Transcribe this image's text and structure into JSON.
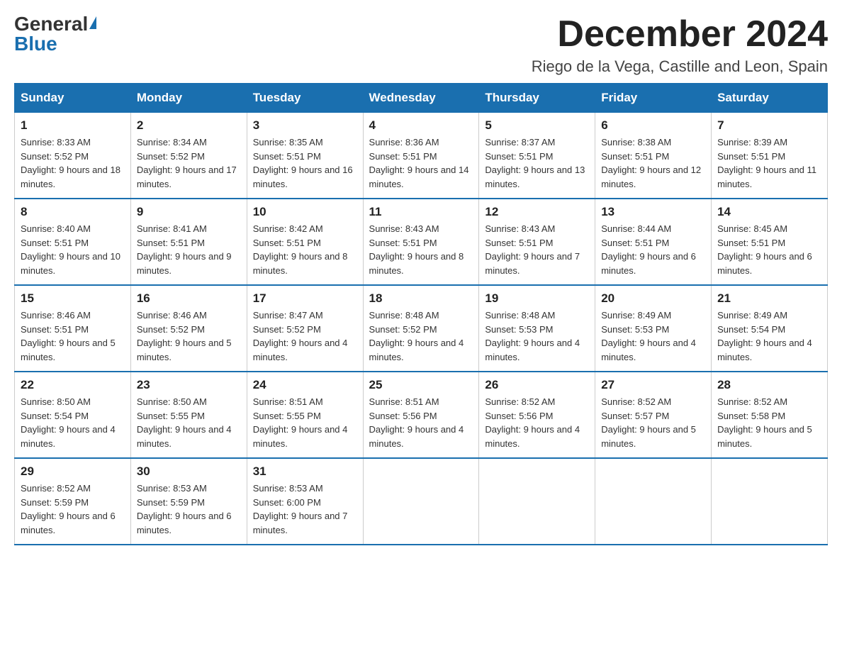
{
  "header": {
    "logo_general": "General",
    "logo_blue": "Blue",
    "month_title": "December 2024",
    "location": "Riego de la Vega, Castille and Leon, Spain"
  },
  "days_of_week": [
    "Sunday",
    "Monday",
    "Tuesday",
    "Wednesday",
    "Thursday",
    "Friday",
    "Saturday"
  ],
  "weeks": [
    [
      {
        "day": "1",
        "sunrise": "8:33 AM",
        "sunset": "5:52 PM",
        "daylight": "9 hours and 18 minutes."
      },
      {
        "day": "2",
        "sunrise": "8:34 AM",
        "sunset": "5:52 PM",
        "daylight": "9 hours and 17 minutes."
      },
      {
        "day": "3",
        "sunrise": "8:35 AM",
        "sunset": "5:51 PM",
        "daylight": "9 hours and 16 minutes."
      },
      {
        "day": "4",
        "sunrise": "8:36 AM",
        "sunset": "5:51 PM",
        "daylight": "9 hours and 14 minutes."
      },
      {
        "day": "5",
        "sunrise": "8:37 AM",
        "sunset": "5:51 PM",
        "daylight": "9 hours and 13 minutes."
      },
      {
        "day": "6",
        "sunrise": "8:38 AM",
        "sunset": "5:51 PM",
        "daylight": "9 hours and 12 minutes."
      },
      {
        "day": "7",
        "sunrise": "8:39 AM",
        "sunset": "5:51 PM",
        "daylight": "9 hours and 11 minutes."
      }
    ],
    [
      {
        "day": "8",
        "sunrise": "8:40 AM",
        "sunset": "5:51 PM",
        "daylight": "9 hours and 10 minutes."
      },
      {
        "day": "9",
        "sunrise": "8:41 AM",
        "sunset": "5:51 PM",
        "daylight": "9 hours and 9 minutes."
      },
      {
        "day": "10",
        "sunrise": "8:42 AM",
        "sunset": "5:51 PM",
        "daylight": "9 hours and 8 minutes."
      },
      {
        "day": "11",
        "sunrise": "8:43 AM",
        "sunset": "5:51 PM",
        "daylight": "9 hours and 8 minutes."
      },
      {
        "day": "12",
        "sunrise": "8:43 AM",
        "sunset": "5:51 PM",
        "daylight": "9 hours and 7 minutes."
      },
      {
        "day": "13",
        "sunrise": "8:44 AM",
        "sunset": "5:51 PM",
        "daylight": "9 hours and 6 minutes."
      },
      {
        "day": "14",
        "sunrise": "8:45 AM",
        "sunset": "5:51 PM",
        "daylight": "9 hours and 6 minutes."
      }
    ],
    [
      {
        "day": "15",
        "sunrise": "8:46 AM",
        "sunset": "5:51 PM",
        "daylight": "9 hours and 5 minutes."
      },
      {
        "day": "16",
        "sunrise": "8:46 AM",
        "sunset": "5:52 PM",
        "daylight": "9 hours and 5 minutes."
      },
      {
        "day": "17",
        "sunrise": "8:47 AM",
        "sunset": "5:52 PM",
        "daylight": "9 hours and 4 minutes."
      },
      {
        "day": "18",
        "sunrise": "8:48 AM",
        "sunset": "5:52 PM",
        "daylight": "9 hours and 4 minutes."
      },
      {
        "day": "19",
        "sunrise": "8:48 AM",
        "sunset": "5:53 PM",
        "daylight": "9 hours and 4 minutes."
      },
      {
        "day": "20",
        "sunrise": "8:49 AM",
        "sunset": "5:53 PM",
        "daylight": "9 hours and 4 minutes."
      },
      {
        "day": "21",
        "sunrise": "8:49 AM",
        "sunset": "5:54 PM",
        "daylight": "9 hours and 4 minutes."
      }
    ],
    [
      {
        "day": "22",
        "sunrise": "8:50 AM",
        "sunset": "5:54 PM",
        "daylight": "9 hours and 4 minutes."
      },
      {
        "day": "23",
        "sunrise": "8:50 AM",
        "sunset": "5:55 PM",
        "daylight": "9 hours and 4 minutes."
      },
      {
        "day": "24",
        "sunrise": "8:51 AM",
        "sunset": "5:55 PM",
        "daylight": "9 hours and 4 minutes."
      },
      {
        "day": "25",
        "sunrise": "8:51 AM",
        "sunset": "5:56 PM",
        "daylight": "9 hours and 4 minutes."
      },
      {
        "day": "26",
        "sunrise": "8:52 AM",
        "sunset": "5:56 PM",
        "daylight": "9 hours and 4 minutes."
      },
      {
        "day": "27",
        "sunrise": "8:52 AM",
        "sunset": "5:57 PM",
        "daylight": "9 hours and 5 minutes."
      },
      {
        "day": "28",
        "sunrise": "8:52 AM",
        "sunset": "5:58 PM",
        "daylight": "9 hours and 5 minutes."
      }
    ],
    [
      {
        "day": "29",
        "sunrise": "8:52 AM",
        "sunset": "5:59 PM",
        "daylight": "9 hours and 6 minutes."
      },
      {
        "day": "30",
        "sunrise": "8:53 AM",
        "sunset": "5:59 PM",
        "daylight": "9 hours and 6 minutes."
      },
      {
        "day": "31",
        "sunrise": "8:53 AM",
        "sunset": "6:00 PM",
        "daylight": "9 hours and 7 minutes."
      },
      null,
      null,
      null,
      null
    ]
  ]
}
